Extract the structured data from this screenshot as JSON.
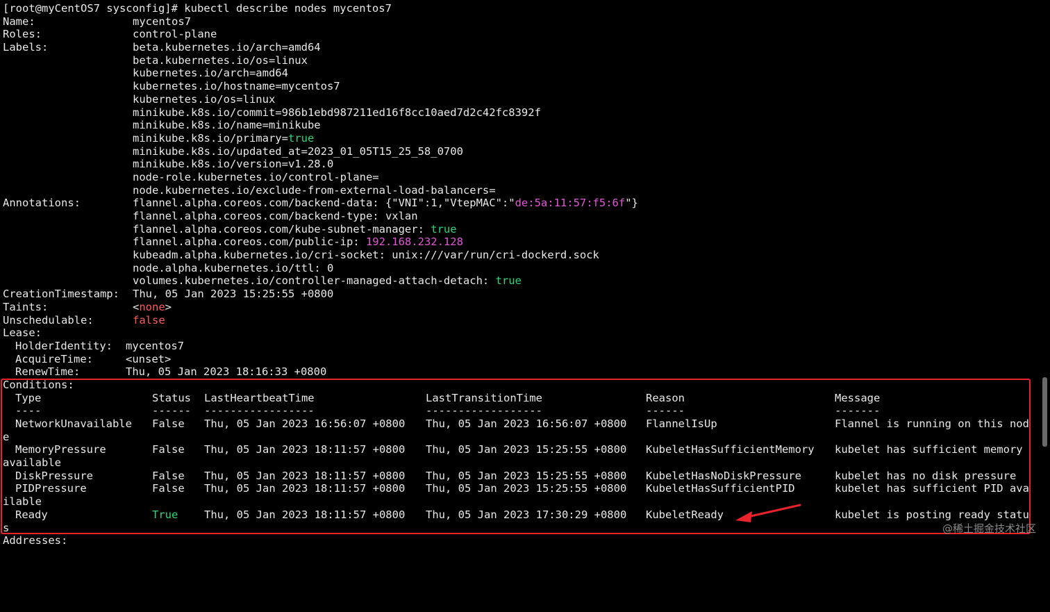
{
  "prompt": {
    "text": "[root@myCentOS7 sysconfig]# kubectl describe nodes mycentos7"
  },
  "name": {
    "key": "Name:",
    "value": "mycentos7"
  },
  "roles": {
    "key": "Roles:",
    "value": "control-plane"
  },
  "labels": {
    "key": "Labels:",
    "items": [
      "beta.kubernetes.io/arch=amd64",
      "beta.kubernetes.io/os=linux",
      "kubernetes.io/arch=amd64",
      "kubernetes.io/hostname=mycentos7",
      "kubernetes.io/os=linux",
      "minikube.k8s.io/commit=986b1ebd987211ed16f8cc10aed7d2c42fc8392f",
      "minikube.k8s.io/name=minikube",
      "minikube.k8s.io/primary=",
      "minikube.k8s.io/updated_at=2023_01_05T15_25_58_0700",
      "minikube.k8s.io/version=v1.28.0",
      "node-role.kubernetes.io/control-plane=",
      "node.kubernetes.io/exclude-from-external-load-balancers="
    ],
    "primary_value": "true"
  },
  "annotations": {
    "key": "Annotations:",
    "backend_data_prefix": "flannel.alpha.coreos.com/backend-data: {\"VNI\":1,\"VtepMAC\":\"",
    "backend_data_mac": "de:5a:11:57:f5:6f",
    "backend_data_suffix": "\"}",
    "backend_type": "flannel.alpha.coreos.com/backend-type: vxlan",
    "subnet_manager_key": "flannel.alpha.coreos.com/kube-subnet-manager: ",
    "subnet_manager_value": "true",
    "public_ip_key": "flannel.alpha.coreos.com/public-ip: ",
    "public_ip_value": "192.168.232.128",
    "cri_socket": "kubeadm.alpha.kubernetes.io/cri-socket: unix:///var/run/cri-dockerd.sock",
    "ttl": "node.alpha.kubernetes.io/ttl: 0",
    "attach_detach_key": "volumes.kubernetes.io/controller-managed-attach-detach: ",
    "attach_detach_value": "true"
  },
  "creation": {
    "key": "CreationTimestamp:",
    "value": "Thu, 05 Jan 2023 15:25:55 +0800"
  },
  "taints": {
    "key": "Taints:",
    "open": "<",
    "value": "none",
    "close": ">"
  },
  "unschedulable": {
    "key": "Unschedulable:",
    "value": "false"
  },
  "lease": {
    "key": "Lease:",
    "holder_key": "HolderIdentity:",
    "holder_value": "mycentos7",
    "acquire_key": "AcquireTime:",
    "acquire_value": "<unset>",
    "renew_key": "RenewTime:",
    "renew_value": "Thu, 05 Jan 2023 18:16:33 +0800"
  },
  "conditions": {
    "key": "Conditions:",
    "headers": [
      "Type",
      "Status",
      "LastHeartbeatTime",
      "LastTransitionTime",
      "Reason",
      "Message"
    ],
    "dashes": [
      "----",
      "------",
      "-----------------",
      "------------------",
      "------",
      "-------"
    ],
    "rows": [
      {
        "type": "NetworkUnavailable",
        "status": "False",
        "heartbeat": "Thu, 05 Jan 2023 16:56:07 +0800",
        "transition": "Thu, 05 Jan 2023 16:56:07 +0800",
        "reason": "FlannelIsUp",
        "message": "Flannel is running on this nod",
        "wrap": "e"
      },
      {
        "type": "MemoryPressure",
        "status": "False",
        "heartbeat": "Thu, 05 Jan 2023 18:11:57 +0800",
        "transition": "Thu, 05 Jan 2023 15:25:55 +0800",
        "reason": "KubeletHasSufficientMemory",
        "message": "kubelet has sufficient memory",
        "wrap": "available"
      },
      {
        "type": "DiskPressure",
        "status": "False",
        "heartbeat": "Thu, 05 Jan 2023 18:11:57 +0800",
        "transition": "Thu, 05 Jan 2023 15:25:55 +0800",
        "reason": "KubeletHasNoDiskPressure",
        "message": "kubelet has no disk pressure",
        "wrap": ""
      },
      {
        "type": "PIDPressure",
        "status": "False",
        "heartbeat": "Thu, 05 Jan 2023 18:11:57 +0800",
        "transition": "Thu, 05 Jan 2023 15:25:55 +0800",
        "reason": "KubeletHasSufficientPID",
        "message": "kubelet has sufficient PID ava",
        "wrap": "ilable"
      },
      {
        "type": "Ready",
        "status": "True",
        "heartbeat": "Thu, 05 Jan 2023 18:11:57 +0800",
        "transition": "Thu, 05 Jan 2023 17:30:29 +0800",
        "reason": "KubeletReady",
        "message": "kubelet is posting ready statu",
        "wrap": "s"
      }
    ]
  },
  "addresses": {
    "key": "Addresses:"
  },
  "watermark": "@稀土掘金技术社区",
  "colors": {
    "background": "#000000",
    "text": "#e8e8e8",
    "green": "#2fd67a",
    "magenta": "#e456d9",
    "red": "#ff5a5a",
    "highlight_box": "#e8232a"
  }
}
